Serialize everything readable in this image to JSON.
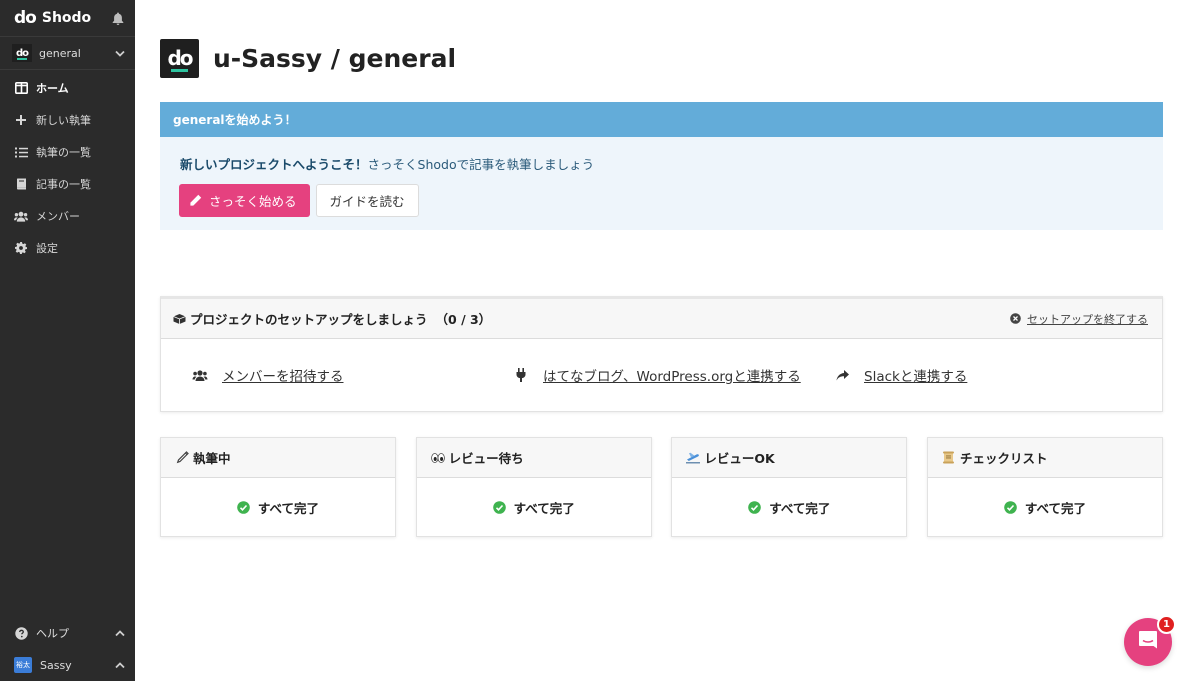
{
  "sidebar": {
    "brand": {
      "logo": "do",
      "name": "Shodo"
    },
    "project": {
      "logo": "do",
      "name": "general"
    },
    "items": [
      {
        "label": "ホーム",
        "icon": "columns-icon",
        "active": true
      },
      {
        "label": "新しい執筆",
        "icon": "plus-icon"
      },
      {
        "label": "執筆の一覧",
        "icon": "list-icon"
      },
      {
        "label": "記事の一覧",
        "icon": "book-icon"
      },
      {
        "label": "メンバー",
        "icon": "users-icon"
      },
      {
        "label": "設定",
        "icon": "gear-icon"
      }
    ],
    "help": {
      "label": "ヘルプ"
    },
    "user": {
      "avatar": "裕太",
      "name": "Sassy"
    }
  },
  "header": {
    "logo": "do",
    "title": "u-Sassy / general"
  },
  "welcome": {
    "heading": "generalを始めよう！",
    "message_strong": "新しいプロジェクトへようこそ！",
    "message": "さっそくShodoで記事を執筆しましょう",
    "start_button": "さっそく始める",
    "guide_button": "ガイドを読む"
  },
  "setup": {
    "title": "プロジェクトのセットアップをしましょう",
    "progress": "（0 / 3）",
    "end_link": "セットアップを終了する",
    "links": [
      {
        "label": "メンバーを招待する",
        "icon": "users-icon"
      },
      {
        "label": "はてなブログ、WordPress.orgと連携する",
        "icon": "plug-icon"
      },
      {
        "label": "Slackと連携する",
        "icon": "share-icon"
      }
    ]
  },
  "cards": [
    {
      "title": "執筆中",
      "icon": "pencil-icon",
      "status": "すべて完了"
    },
    {
      "title": "レビュー待ち",
      "icon": "eyes-icon",
      "status": "すべて完了"
    },
    {
      "title": "レビューOK",
      "icon": "airplane-icon",
      "status": "すべて完了"
    },
    {
      "title": "チェックリスト",
      "icon": "scroll-icon",
      "status": "すべて完了"
    }
  ],
  "chat": {
    "badge": "1"
  },
  "colors": {
    "sidebar_bg": "#2b2b2b",
    "accent_pink": "#e5417f",
    "welcome_header": "#63acd9",
    "welcome_bg": "#eef5fb",
    "success_green": "#3fb34f",
    "badge_red": "#e02020"
  }
}
